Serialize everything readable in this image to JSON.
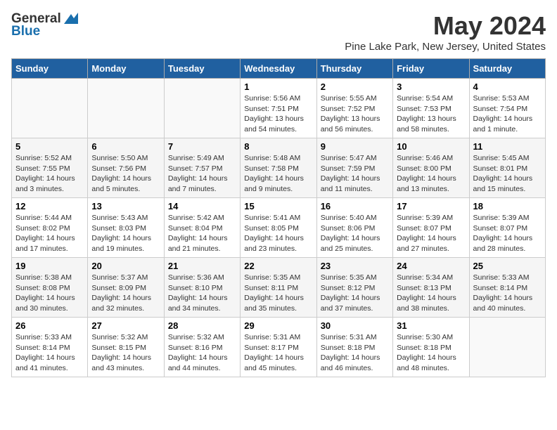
{
  "header": {
    "logo_general": "General",
    "logo_blue": "Blue",
    "month": "May 2024",
    "location": "Pine Lake Park, New Jersey, United States"
  },
  "columns": [
    "Sunday",
    "Monday",
    "Tuesday",
    "Wednesday",
    "Thursday",
    "Friday",
    "Saturday"
  ],
  "weeks": [
    {
      "days": [
        {
          "num": "",
          "info": ""
        },
        {
          "num": "",
          "info": ""
        },
        {
          "num": "",
          "info": ""
        },
        {
          "num": "1",
          "info": "Sunrise: 5:56 AM\nSunset: 7:51 PM\nDaylight: 13 hours\nand 54 minutes."
        },
        {
          "num": "2",
          "info": "Sunrise: 5:55 AM\nSunset: 7:52 PM\nDaylight: 13 hours\nand 56 minutes."
        },
        {
          "num": "3",
          "info": "Sunrise: 5:54 AM\nSunset: 7:53 PM\nDaylight: 13 hours\nand 58 minutes."
        },
        {
          "num": "4",
          "info": "Sunrise: 5:53 AM\nSunset: 7:54 PM\nDaylight: 14 hours\nand 1 minute."
        }
      ]
    },
    {
      "days": [
        {
          "num": "5",
          "info": "Sunrise: 5:52 AM\nSunset: 7:55 PM\nDaylight: 14 hours\nand 3 minutes."
        },
        {
          "num": "6",
          "info": "Sunrise: 5:50 AM\nSunset: 7:56 PM\nDaylight: 14 hours\nand 5 minutes."
        },
        {
          "num": "7",
          "info": "Sunrise: 5:49 AM\nSunset: 7:57 PM\nDaylight: 14 hours\nand 7 minutes."
        },
        {
          "num": "8",
          "info": "Sunrise: 5:48 AM\nSunset: 7:58 PM\nDaylight: 14 hours\nand 9 minutes."
        },
        {
          "num": "9",
          "info": "Sunrise: 5:47 AM\nSunset: 7:59 PM\nDaylight: 14 hours\nand 11 minutes."
        },
        {
          "num": "10",
          "info": "Sunrise: 5:46 AM\nSunset: 8:00 PM\nDaylight: 14 hours\nand 13 minutes."
        },
        {
          "num": "11",
          "info": "Sunrise: 5:45 AM\nSunset: 8:01 PM\nDaylight: 14 hours\nand 15 minutes."
        }
      ]
    },
    {
      "days": [
        {
          "num": "12",
          "info": "Sunrise: 5:44 AM\nSunset: 8:02 PM\nDaylight: 14 hours\nand 17 minutes."
        },
        {
          "num": "13",
          "info": "Sunrise: 5:43 AM\nSunset: 8:03 PM\nDaylight: 14 hours\nand 19 minutes."
        },
        {
          "num": "14",
          "info": "Sunrise: 5:42 AM\nSunset: 8:04 PM\nDaylight: 14 hours\nand 21 minutes."
        },
        {
          "num": "15",
          "info": "Sunrise: 5:41 AM\nSunset: 8:05 PM\nDaylight: 14 hours\nand 23 minutes."
        },
        {
          "num": "16",
          "info": "Sunrise: 5:40 AM\nSunset: 8:06 PM\nDaylight: 14 hours\nand 25 minutes."
        },
        {
          "num": "17",
          "info": "Sunrise: 5:39 AM\nSunset: 8:07 PM\nDaylight: 14 hours\nand 27 minutes."
        },
        {
          "num": "18",
          "info": "Sunrise: 5:39 AM\nSunset: 8:07 PM\nDaylight: 14 hours\nand 28 minutes."
        }
      ]
    },
    {
      "days": [
        {
          "num": "19",
          "info": "Sunrise: 5:38 AM\nSunset: 8:08 PM\nDaylight: 14 hours\nand 30 minutes."
        },
        {
          "num": "20",
          "info": "Sunrise: 5:37 AM\nSunset: 8:09 PM\nDaylight: 14 hours\nand 32 minutes."
        },
        {
          "num": "21",
          "info": "Sunrise: 5:36 AM\nSunset: 8:10 PM\nDaylight: 14 hours\nand 34 minutes."
        },
        {
          "num": "22",
          "info": "Sunrise: 5:35 AM\nSunset: 8:11 PM\nDaylight: 14 hours\nand 35 minutes."
        },
        {
          "num": "23",
          "info": "Sunrise: 5:35 AM\nSunset: 8:12 PM\nDaylight: 14 hours\nand 37 minutes."
        },
        {
          "num": "24",
          "info": "Sunrise: 5:34 AM\nSunset: 8:13 PM\nDaylight: 14 hours\nand 38 minutes."
        },
        {
          "num": "25",
          "info": "Sunrise: 5:33 AM\nSunset: 8:14 PM\nDaylight: 14 hours\nand 40 minutes."
        }
      ]
    },
    {
      "days": [
        {
          "num": "26",
          "info": "Sunrise: 5:33 AM\nSunset: 8:14 PM\nDaylight: 14 hours\nand 41 minutes."
        },
        {
          "num": "27",
          "info": "Sunrise: 5:32 AM\nSunset: 8:15 PM\nDaylight: 14 hours\nand 43 minutes."
        },
        {
          "num": "28",
          "info": "Sunrise: 5:32 AM\nSunset: 8:16 PM\nDaylight: 14 hours\nand 44 minutes."
        },
        {
          "num": "29",
          "info": "Sunrise: 5:31 AM\nSunset: 8:17 PM\nDaylight: 14 hours\nand 45 minutes."
        },
        {
          "num": "30",
          "info": "Sunrise: 5:31 AM\nSunset: 8:18 PM\nDaylight: 14 hours\nand 46 minutes."
        },
        {
          "num": "31",
          "info": "Sunrise: 5:30 AM\nSunset: 8:18 PM\nDaylight: 14 hours\nand 48 minutes."
        },
        {
          "num": "",
          "info": ""
        }
      ]
    }
  ]
}
